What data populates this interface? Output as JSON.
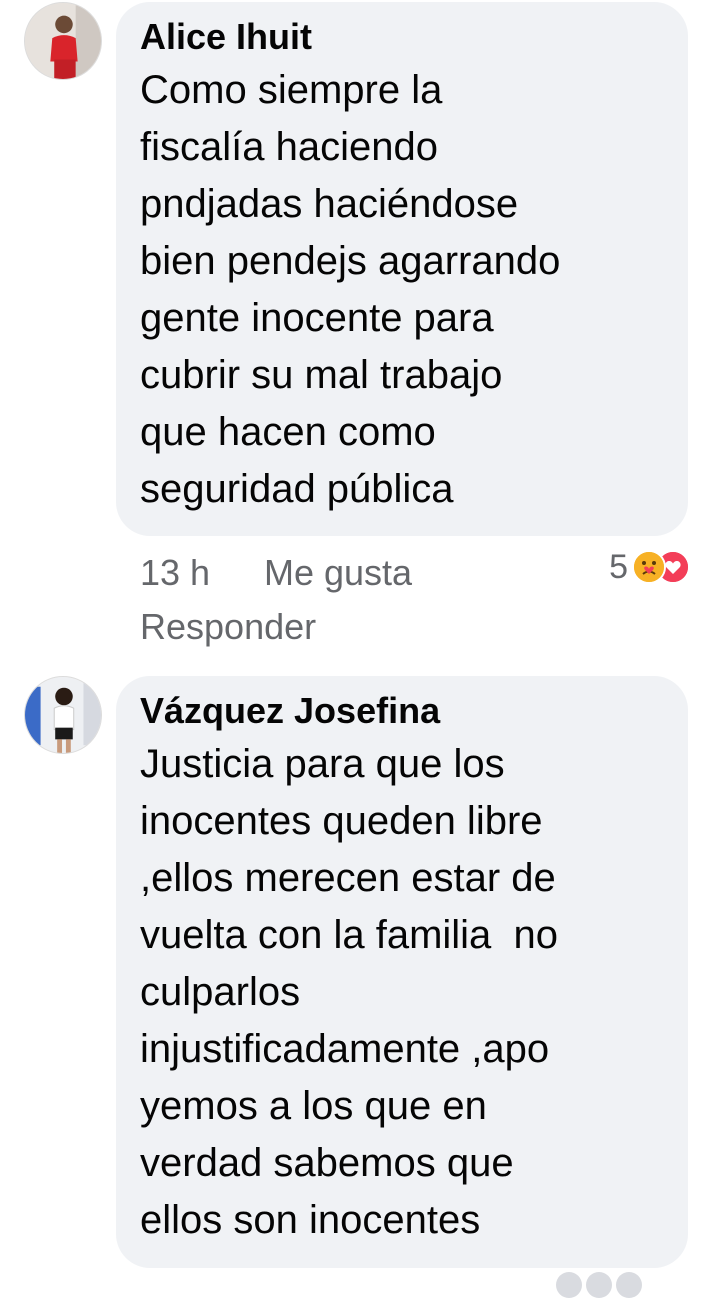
{
  "comments": [
    {
      "author": "Alice Ihuit",
      "text_lines": [
        "Como siempre la",
        "fiscalía haciendo",
        "pndjadas haciéndose",
        "bien pendejs agarrando",
        "gente inocente para",
        "cubrir su mal trabajo",
        "que hacen como",
        "seguridad pública"
      ],
      "time": "13 h",
      "like_label": "Me gusta",
      "reply_label": "Responder",
      "reaction_count": "5",
      "reaction_icons": [
        "care-icon",
        "love-icon"
      ]
    },
    {
      "author": "Vázquez Josefina",
      "text_lines": [
        "Justicia para que los",
        "inocentes queden libre",
        ",ellos merecen estar de",
        "vuelta con la familia  no",
        "culparlos",
        "injustificadamente ,apo",
        "yemos a los que en",
        "verdad sabemos que",
        "ellos son inocentes"
      ]
    }
  ],
  "colors": {
    "bubble": "#f0f2f5",
    "meta_text": "#65676b",
    "care": "#f7b125",
    "love": "#f33e58"
  }
}
